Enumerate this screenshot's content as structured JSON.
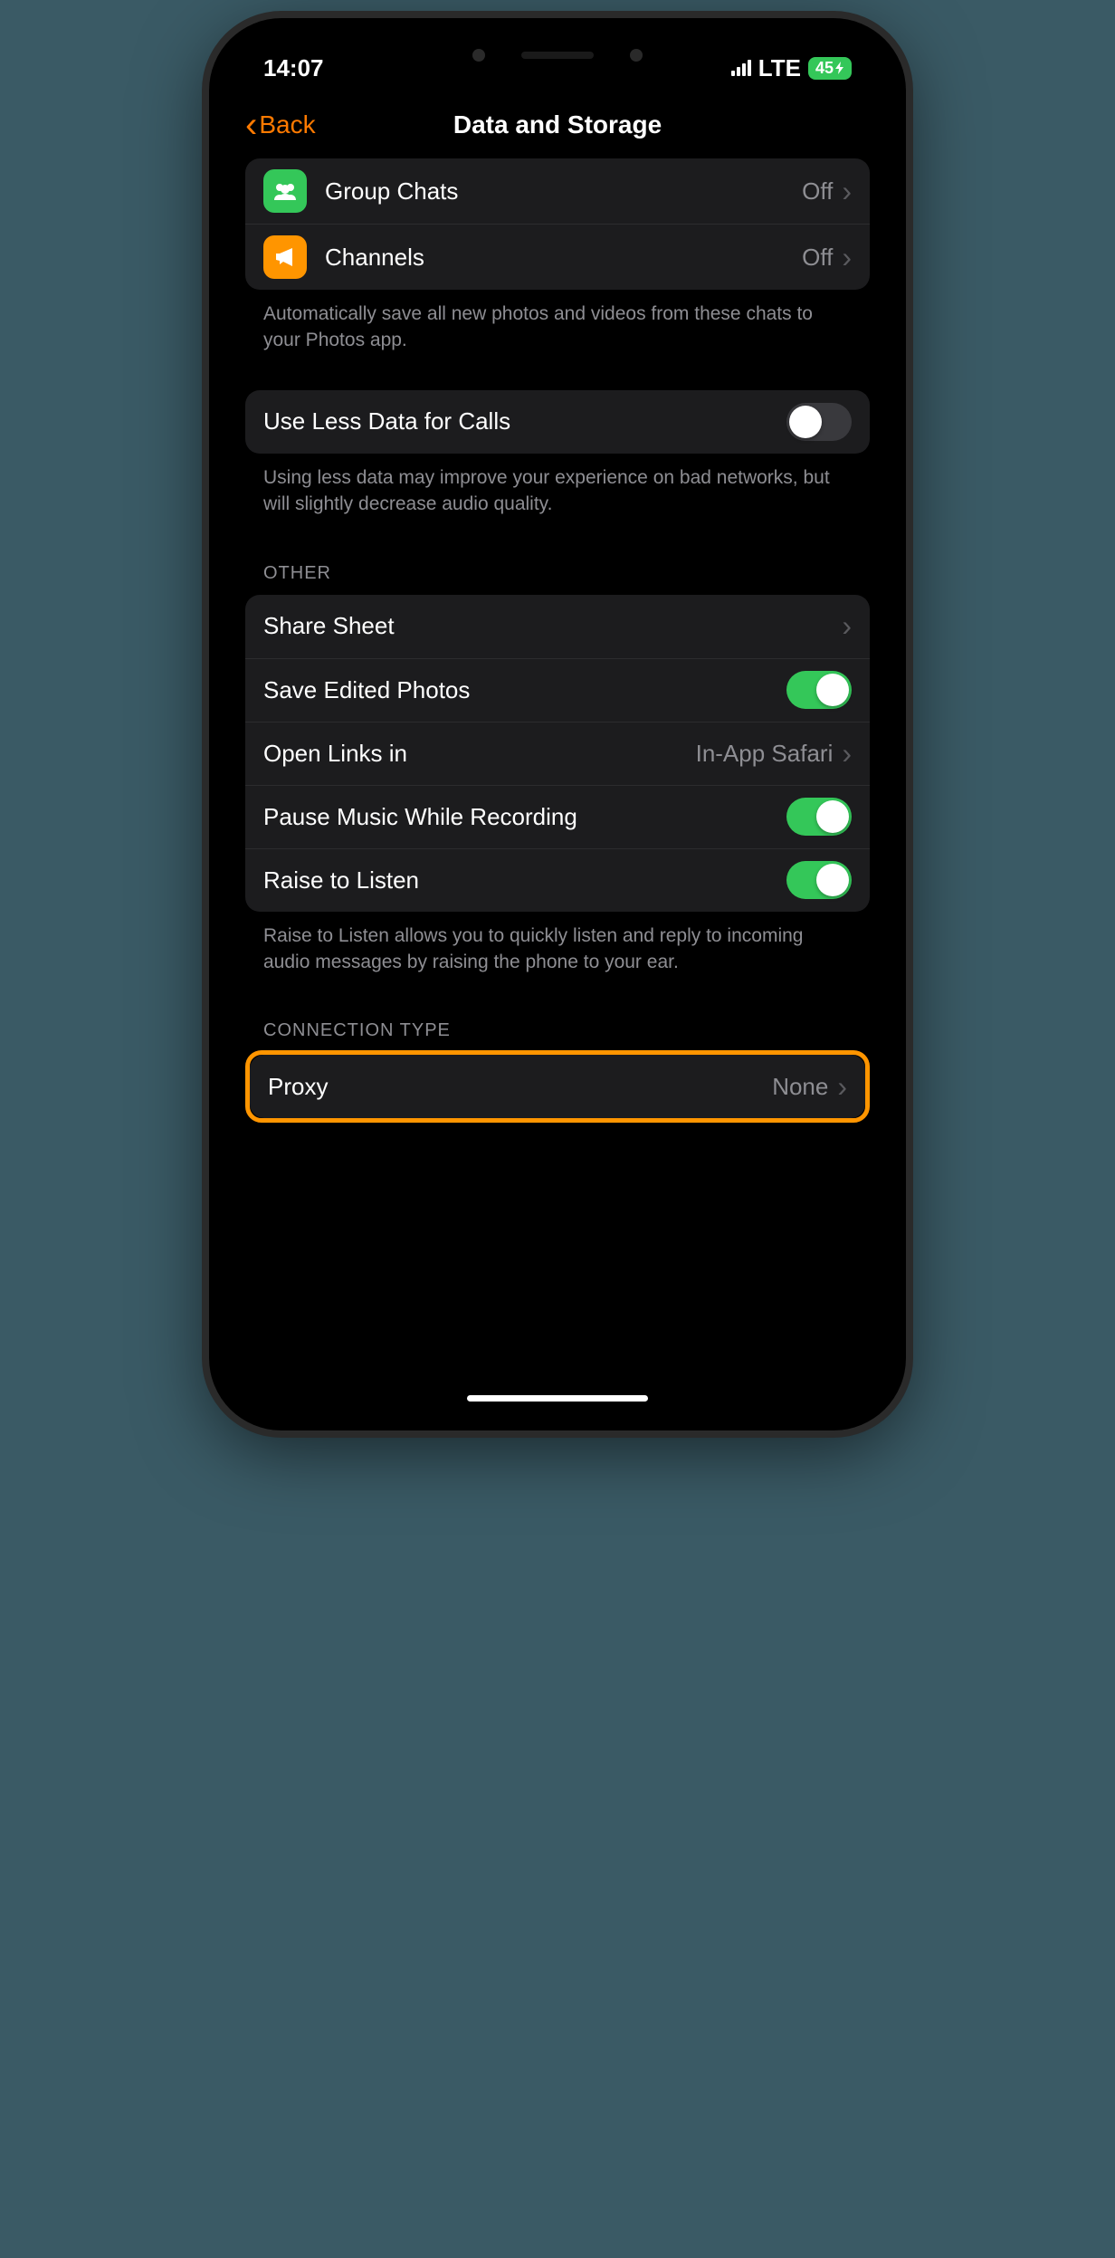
{
  "status": {
    "time": "14:07",
    "network": "LTE",
    "battery": "45"
  },
  "nav": {
    "back_label": "Back",
    "title": "Data and Storage"
  },
  "autosave": {
    "rows": {
      "group_chats": {
        "label": "Group Chats",
        "value": "Off"
      },
      "channels": {
        "label": "Channels",
        "value": "Off"
      }
    },
    "footer": "Automatically save all new photos and videos from these chats to your Photos app."
  },
  "calls": {
    "label": "Use Less Data for Calls",
    "footer": "Using less data may improve your experience on bad networks, but will slightly decrease audio quality."
  },
  "other": {
    "header": "OTHER",
    "share_sheet": {
      "label": "Share Sheet"
    },
    "save_edited": {
      "label": "Save Edited Photos"
    },
    "open_links": {
      "label": "Open Links in",
      "value": "In-App Safari"
    },
    "pause_music": {
      "label": "Pause Music While Recording"
    },
    "raise_listen": {
      "label": "Raise to Listen"
    },
    "footer": "Raise to Listen allows you to quickly listen and reply to incoming audio messages by raising the phone to your ear."
  },
  "connection": {
    "header": "CONNECTION TYPE",
    "proxy": {
      "label": "Proxy",
      "value": "None"
    }
  }
}
